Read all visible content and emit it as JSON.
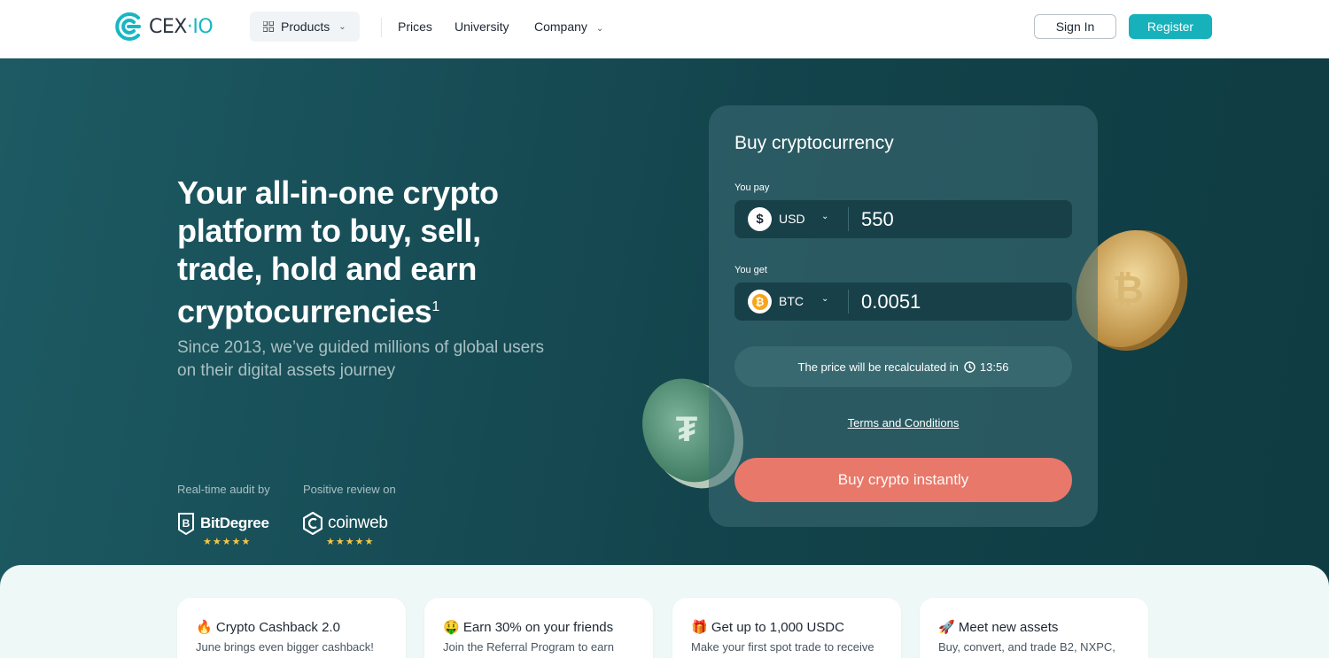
{
  "header": {
    "logo_text_a": "CEX",
    "logo_text_b": "IO",
    "products_label": "Products",
    "nav": [
      "Prices",
      "University",
      "Company"
    ],
    "signin_label": "Sign In",
    "register_label": "Register",
    "accent_color": "#17b1bb"
  },
  "hero": {
    "title": "Your all-in-one crypto platform to buy, sell, trade, hold and earn cryptocurrencies",
    "title_sup": "1",
    "subtitle": "Since 2013, we’ve guided millions of global users on their digital assets journey",
    "audit_label": "Real-time audit by",
    "review_label": "Positive review on",
    "badge1": "BitDegree",
    "badge2": "coinweb",
    "badge1_stars": "★★★★★",
    "badge2_stars": "★★★★★"
  },
  "buy": {
    "title": "Buy cryptocurrency",
    "pay_label": "You pay",
    "pay_currency": "USD",
    "pay_icon": "$",
    "pay_value": "550",
    "get_label": "You get",
    "get_currency": "BTC",
    "get_icon": "₿",
    "get_value": "0.0051",
    "recalc_text": "The price will be recalculated in",
    "timer": "13:56",
    "terms": "Terms and Conditions",
    "button": "Buy crypto instantly",
    "button_color": "#e8786a"
  },
  "promos": [
    {
      "emoji": "🔥",
      "title": "Crypto Cashback 2.0",
      "desc": "June brings even bigger cashback!"
    },
    {
      "emoji": "🤑",
      "title": "Earn 30% on your friends",
      "desc": "Join the Referral Program to earn"
    },
    {
      "emoji": "🎁",
      "title": "Get up to 1,000 USDC",
      "desc": "Make your first spot trade to receive"
    },
    {
      "emoji": "🚀",
      "title": "Meet new assets",
      "desc": "Buy, convert, and trade B2, NXPC,"
    }
  ]
}
